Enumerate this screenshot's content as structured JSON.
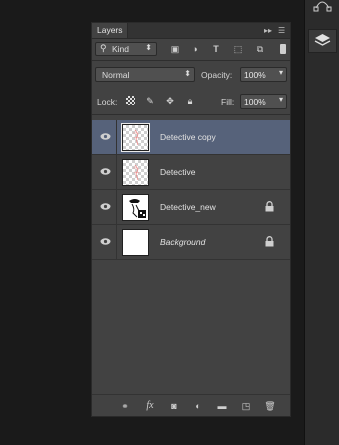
{
  "panel": {
    "tab_label": "Layers",
    "icons": {
      "collapse": "double-chevron-icon",
      "menu": "panel-menu-icon",
      "filter_toggle": "filter-toggle-icon"
    },
    "filter": {
      "kind_label": "Kind",
      "filter_icons": [
        "pixel-filter-icon",
        "adjustment-filter-icon",
        "type-filter-icon",
        "shape-filter-icon",
        "smart-object-filter-icon"
      ]
    },
    "blend_mode": "Normal",
    "opacity_label": "Opacity:",
    "opacity_value": "100%",
    "lock_label": "Lock:",
    "fill_label": "Fill:",
    "fill_value": "100%",
    "lock_icons": [
      "lock-transparent-icon",
      "lock-image-icon",
      "lock-position-icon",
      "lock-all-icon"
    ]
  },
  "layers": [
    {
      "name": "Detective copy",
      "visible": true,
      "selected": true,
      "thumb": "checker",
      "locked": false
    },
    {
      "name": "Detective",
      "visible": true,
      "selected": false,
      "thumb": "checker",
      "locked": false
    },
    {
      "name": "Detective_new",
      "visible": true,
      "selected": false,
      "thumb": "sketch",
      "locked": true
    },
    {
      "name": "Background",
      "visible": true,
      "selected": false,
      "thumb": "white",
      "locked": true,
      "italic": true
    }
  ],
  "footer": {
    "fx_label": "fx",
    "icons": [
      "link-layers-icon",
      "fx-icon",
      "add-mask-icon",
      "adjustment-layer-icon",
      "new-group-icon",
      "new-layer-icon",
      "delete-layer-icon"
    ]
  },
  "dock": {
    "icons": [
      "paths-icon",
      "layers-icon"
    ]
  },
  "colors": {
    "panel_bg": "#424242",
    "selected_row": "#56627a",
    "app_bg": "#1a1a1a"
  }
}
